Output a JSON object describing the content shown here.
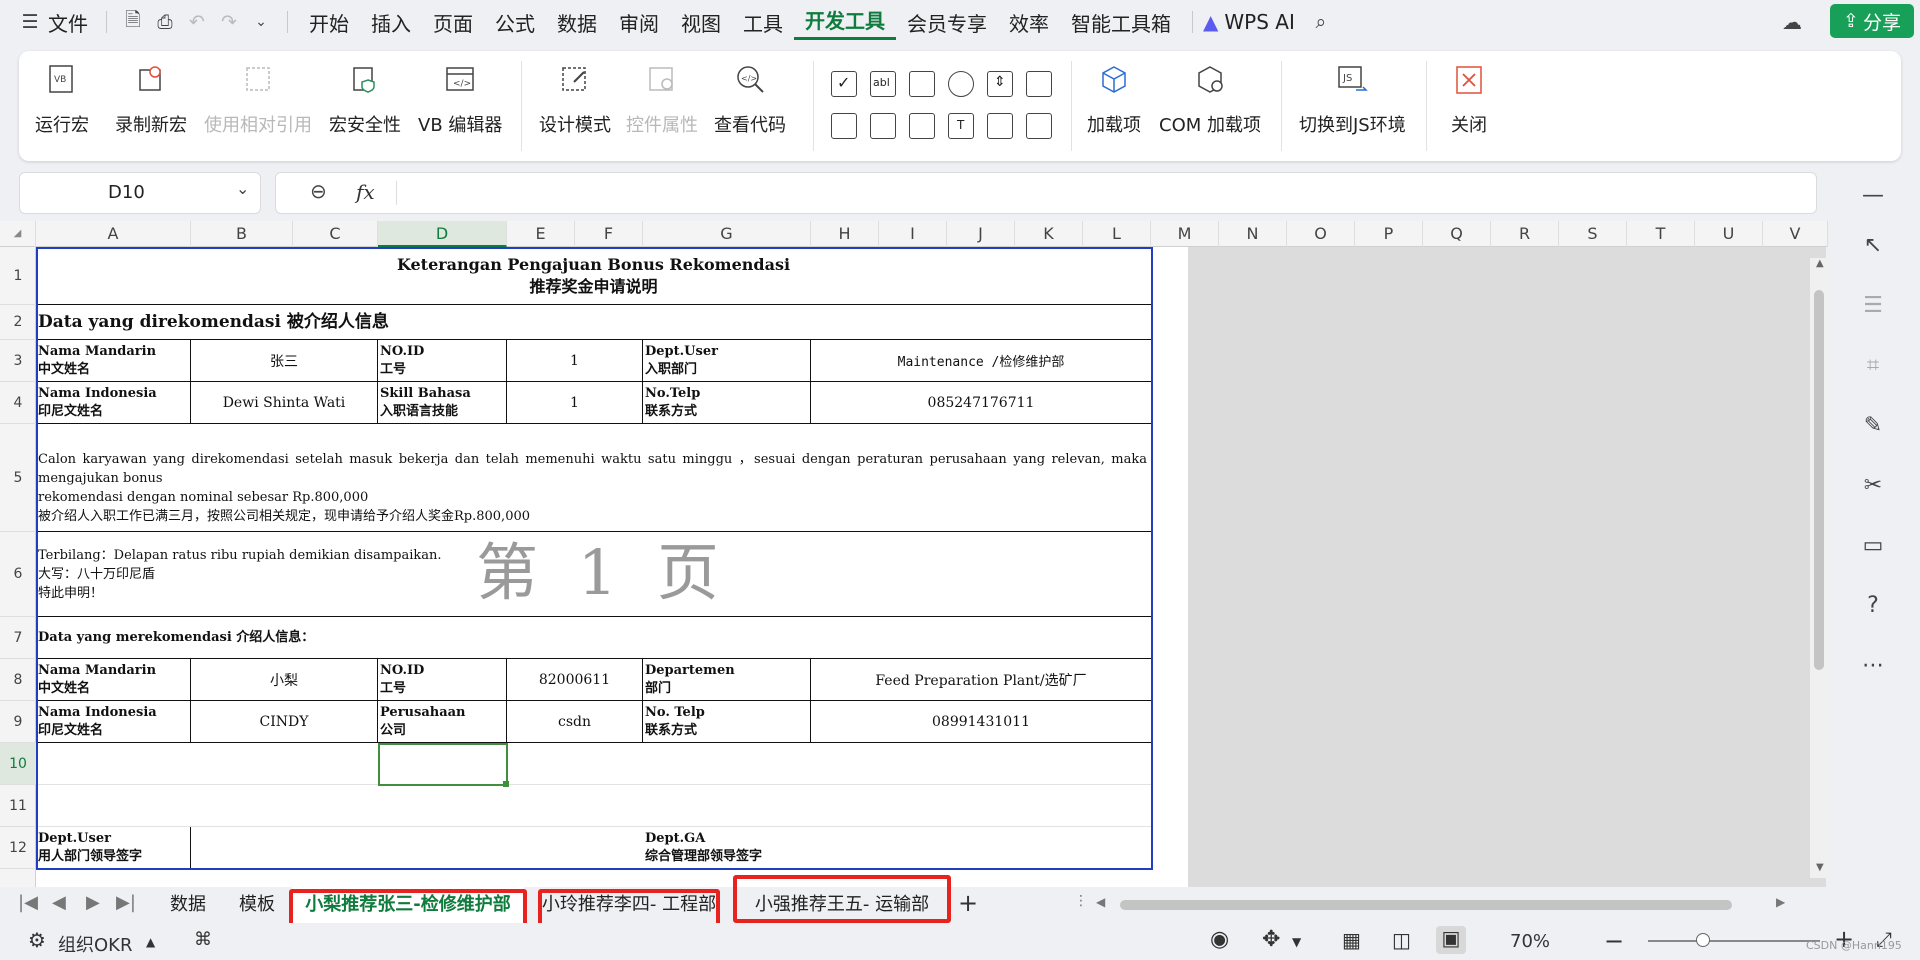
{
  "menubar": {
    "file": "文件",
    "items": [
      "开始",
      "插入",
      "页面",
      "公式",
      "数据",
      "审阅",
      "视图",
      "工具",
      "开发工具",
      "会员专享",
      "效率",
      "智能工具箱"
    ],
    "active": "开发工具",
    "wps_ai": "WPS AI",
    "share": "分享"
  },
  "ribbon": {
    "buttons": [
      "运行宏",
      "录制新宏",
      "使用相对引用",
      "宏安全性",
      "VB 编辑器",
      "设计模式",
      "控件属性",
      "查看代码",
      "加载项",
      "COM 加载项",
      "切换到JS环境",
      "关闭"
    ]
  },
  "formula_bar": {
    "name_box": "D10",
    "fx": "fx"
  },
  "columns": [
    "A",
    "B",
    "C",
    "D",
    "E",
    "F",
    "G",
    "H",
    "I",
    "J",
    "K",
    "L",
    "M",
    "N",
    "O",
    "P",
    "Q",
    "R",
    "S",
    "T",
    "U",
    "V"
  ],
  "rows": [
    "1",
    "2",
    "3",
    "4",
    "5",
    "6",
    "7",
    "8",
    "9",
    "10",
    "11",
    "12"
  ],
  "sheet": {
    "title_id": "Keterangan Pengajuan Bonus Rekomendasi",
    "title_cn": "推荐奖金申请说明",
    "section1": "Data yang direkomendasi 被介绍人信息",
    "r3": {
      "a1": "Nama Mandarin",
      "a2": "中文姓名",
      "b": "张三",
      "d1": "NO.ID",
      "d2": "工号",
      "e": "1",
      "g1": "Dept.User",
      "g2": "入职部门",
      "h": "Maintenance /检修维护部"
    },
    "r4": {
      "a1": "Nama Indonesia",
      "a2": "印尼文姓名",
      "b": "Dewi Shinta Wati",
      "d1": "Skill Bahasa",
      "d2": "入职语言技能",
      "e": "1",
      "g1": "No.Telp",
      "g2": "联系方式",
      "h": "085247176711"
    },
    "r5": {
      "l1": "Calon karyawan yang direkomendasi setelah masuk bekerja dan telah memenuhi waktu satu minggu ，sesuai dengan peraturan perusahaan yang relevan, maka mengajukan bonus",
      "l2": "rekomendasi dengan nominal sebesar Rp.800,000",
      "l3": "被介绍人入职工作已满三月，按照公司相关规定，现申请给予介绍人奖金Rp.800,000"
    },
    "r6": {
      "l1": "Terbilang：Delapan ratus ribu rupiah      demikian disampaikan.",
      "l2": "大写：八十万印尼盾",
      "l3": "特此申明！"
    },
    "section2": "Data yang merekomendasi 介绍人信息：",
    "r8": {
      "a1": "Nama Mandarin",
      "a2": "中文姓名",
      "b": "小梨",
      "d1": "NO.ID",
      "d2": "工号",
      "e": "82000611",
      "g1": "Departemen",
      "g2": "部门",
      "h": "Feed Preparation Plant/选矿厂"
    },
    "r9": {
      "a1": "Nama Indonesia",
      "a2": "印尼文姓名",
      "b": "CINDY",
      "d1": "Perusahaan",
      "d2": "公司",
      "e": "csdn",
      "g1": "No. Telp",
      "g2": "联系方式",
      "h": "08991431011"
    },
    "r12": {
      "a1": "Dept.User",
      "a2": "用人部门领导签字",
      "g1": "Dept.GA",
      "g2": "综合管理部领导签字"
    },
    "watermark": "第 1 页"
  },
  "tabs": [
    "数据",
    "模板",
    "小梨推荐张三-检修维护部",
    "小玲推荐李四- 工程部",
    "小强推荐王五- 运输部"
  ],
  "active_tab": "小梨推荐张三-检修维护部",
  "status": {
    "org": "组织OKR",
    "zoom": "70%",
    "watermark": "CSDN @Hann195"
  },
  "colors": {
    "accent": "#0f7b3c",
    "highlight": "#e8231f",
    "share": "#18a058"
  }
}
